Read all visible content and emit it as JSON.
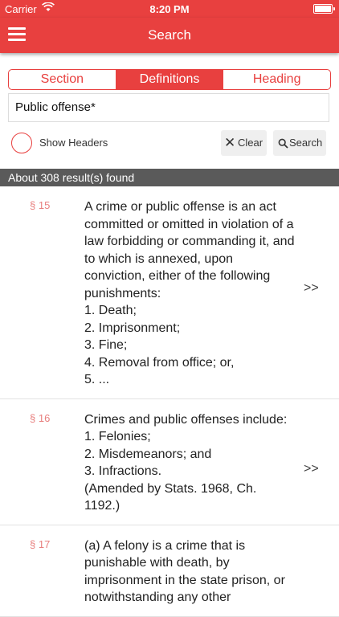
{
  "status": {
    "carrier": "Carrier",
    "time": "8:20 PM"
  },
  "nav": {
    "title": "Search"
  },
  "tabs": [
    {
      "label": "Section",
      "active": false
    },
    {
      "label": "Definitions",
      "active": true
    },
    {
      "label": "Heading",
      "active": false
    }
  ],
  "search": {
    "value": "Public offense*"
  },
  "options": {
    "show_headers_label": "Show Headers",
    "clear_label": "Clear",
    "search_label": "Search"
  },
  "results": {
    "summary": "About 308 result(s) found",
    "items": [
      {
        "section": "§ 15",
        "text": "A crime or public offense is an act committed or omitted in violation of a law forbidding or commanding it, and to which is annexed, upon conviction, either of the following punishments:\n1. Death;\n2. Imprisonment;\n3. Fine;\n4. Removal from office; or,\n5. ..."
      },
      {
        "section": "§ 16",
        "text": "Crimes and public offenses include:\n1. Felonies;\n2. Misdemeanors; and\n3. Infractions.\n(Amended by Stats. 1968, Ch. 1192.)"
      },
      {
        "section": "§ 17",
        "text": "(a) A felony is a crime that is punishable with death, by imprisonment in the state prison, or notwithstanding any other"
      }
    ]
  },
  "colors": {
    "accent": "#e8403f",
    "result_bar": "#5a5a5a",
    "section_number": "#e8807f"
  }
}
